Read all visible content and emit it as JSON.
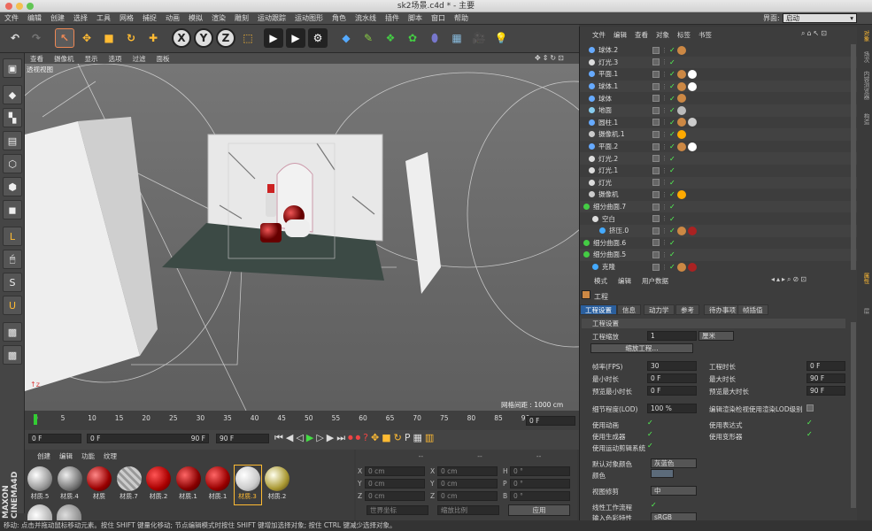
{
  "window": {
    "title": "sk2场景.c4d * - 主要",
    "layout_label": "界面:",
    "layout_value": "启动"
  },
  "menu": [
    "文件",
    "编辑",
    "创建",
    "选择",
    "工具",
    "网格",
    "捕捉",
    "动画",
    "模拟",
    "渲染",
    "雕刻",
    "运动跟踪",
    "运动图形",
    "角色",
    "流水线",
    "插件",
    "脚本",
    "窗口",
    "帮助"
  ],
  "viewport": {
    "menu": [
      "查看",
      "摄像机",
      "显示",
      "选项",
      "过滤",
      "面板"
    ],
    "label": "透视视图",
    "grid_info": "网格间距 : 1000 cm"
  },
  "timeline": {
    "ticks": [
      "0",
      "5",
      "10",
      "15",
      "20",
      "25",
      "30",
      "35",
      "40",
      "45",
      "50",
      "55",
      "60",
      "65",
      "70",
      "75",
      "80",
      "85",
      "90"
    ],
    "frame_end": "0 F",
    "field_start": "0 F",
    "field_range_start": "0 F",
    "field_range_end": "90 F",
    "field_end": "90 F"
  },
  "materials": {
    "menu": [
      "创建",
      "编辑",
      "功能",
      "纹理"
    ],
    "items": [
      "材质.5",
      "材质.4",
      "材质",
      "材质.7",
      "材质.2",
      "材质.1",
      "材质.1",
      "材质.3",
      "材质.2"
    ]
  },
  "coords": {
    "header": [
      "--",
      "--",
      "--"
    ],
    "rows": [
      [
        "X",
        "0 cm",
        "X",
        "0 cm",
        "H",
        "0 °"
      ],
      [
        "Y",
        "0 cm",
        "Y",
        "0 cm",
        "P",
        "0 °"
      ],
      [
        "Z",
        "0 cm",
        "Z",
        "0 cm",
        "B",
        "0 °"
      ]
    ],
    "mode": "世界坐标",
    "scale": "缩放比例",
    "apply": "应用"
  },
  "objects": {
    "menu": [
      "文件",
      "编辑",
      "查看",
      "对象",
      "标签",
      "书签"
    ],
    "rows": [
      "球体.2",
      "灯光.3",
      "平面.1",
      "球体.1",
      "球体",
      "地面",
      "圆柱.1",
      "摄像机.1",
      "平面.2",
      "灯光.2",
      "灯光.1",
      "灯光",
      "摄像机",
      "细分曲面.7",
      "空白",
      "挤压.0",
      "细分曲面.6",
      "细分曲面.5",
      "克隆"
    ]
  },
  "attributes": {
    "menu": [
      "模式",
      "编辑",
      "用户数据"
    ],
    "object_name": "工程",
    "tabs": [
      "工程设置",
      "信息",
      "动力学",
      "参考",
      "待办事项",
      "帧插值"
    ],
    "section": "工程设置",
    "scale_label": "工程缩放",
    "scale_value": "1",
    "scale_unit": "厘米",
    "scale_button": "缩放工程...",
    "fps_label": "帧率(FPS)",
    "fps_value": "30",
    "min_label": "最小时长",
    "min_value": "0 F",
    "preview_min_label": "预览最小时长",
    "preview_min_value": "0 F",
    "duration_label": "工程时长",
    "duration_value": "0 F",
    "max_label": "最大时长",
    "max_value": "90 F",
    "preview_max_label": "预览最大时长",
    "preview_max_value": "90 F",
    "lod_label": "细节程度(LOD)",
    "lod_value": "100 %",
    "lod_render_label": "编辑渲染检视使用渲染LOD级别",
    "use_anim": "使用动画",
    "use_gen": "使用生成器",
    "use_motion": "使用运动剪辑系统",
    "use_expr": "使用表达式",
    "use_deform": "使用变形器",
    "default_color_label": "默认对象颜色",
    "default_color_value": "灰蓝色",
    "color_label": "颜色",
    "view_clip_label": "视图修剪",
    "view_clip_value": "中",
    "linear_label": "线性工作流程",
    "input_color_label": "输入色彩特性",
    "input_color_value": "sRGB"
  },
  "side_tabs": [
    "对象",
    "场次",
    "内容浏览器",
    "构造",
    "属性",
    "层"
  ],
  "status": "移动: 点击并拖动鼠标移动元素。按住 SHIFT 键量化移动; 节点编辑模式时按住 SHIFT 键增加选择对象; 按住 CTRL 键减少选择对象。"
}
